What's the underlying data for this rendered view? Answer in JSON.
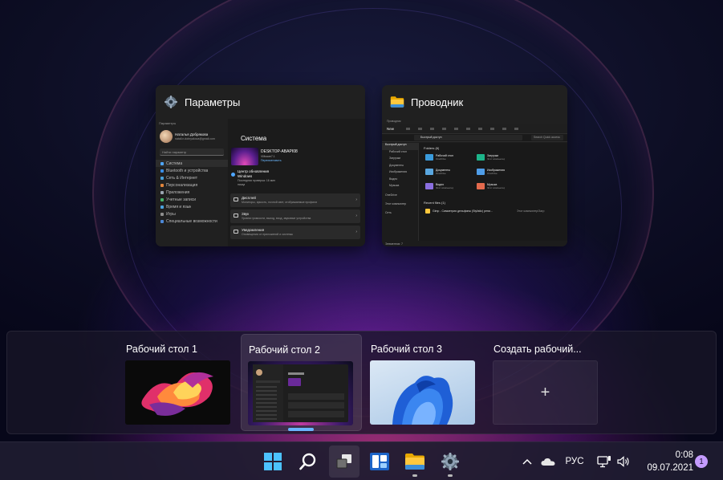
{
  "windows": [
    {
      "title": "Параметры",
      "preview": {
        "topbar": "Параметры",
        "user_name": "Наталья Добрякова",
        "user_email": "natali.n.dobryakova@gmail.com",
        "search_placeholder": "Найти параметр",
        "nav": [
          "Система",
          "Bluetooth и устройства",
          "Сеть & Интернет",
          "Персонализация",
          "Приложения",
          "Учетные записи",
          "Время и язык",
          "Игры",
          "Специальные возможности"
        ],
        "page_title": "Система",
        "device_name": "DESKTOP-ABAPI08",
        "device_sub1": "VMware7.1",
        "device_sub2": "Переименовать",
        "update_title": "Центр обновления",
        "update_title2": "Windows",
        "update_sub": "Последняя проверка: 16 мин",
        "update_sub2": "назад",
        "cards": [
          {
            "title": "Дисплей",
            "sub": "Мониторы, яркость, ночной свет, отображаемые профили"
          },
          {
            "title": "Звук",
            "sub": "Уровни громкости, выход, вход, звуковые устройства"
          },
          {
            "title": "Уведомления",
            "sub": "Оповещения от приложений и системы"
          }
        ]
      }
    },
    {
      "title": "Проводник",
      "preview": {
        "topbar": "Проводник",
        "new_label": "New",
        "address": "Быстрый доступ",
        "search_placeholder": "Search Quick access",
        "tree": [
          "Быстрый доступ",
          "Рабочий стол",
          "Загрузки",
          "Документы",
          "Изображения",
          "Видео",
          "Музыка",
          "OneDrive",
          "Этот компьютер",
          "Сеть"
        ],
        "folders_header": "Folders (6)",
        "folders": [
          {
            "name": "Рабочий стол",
            "sub": "OneDrive"
          },
          {
            "name": "Загрузки",
            "sub": "Этот компьютер"
          },
          {
            "name": "Документы",
            "sub": "OneDrive"
          },
          {
            "name": "Изображения",
            "sub": "OneDrive"
          },
          {
            "name": "Видео",
            "sub": "Этот компьютер"
          },
          {
            "name": "Музыка",
            "sub": "Этот компьютер"
          }
        ],
        "recent_header": "Recent files (1)",
        "recent_file": "Gimp - Симметрия дельфины (Stylistic) репи...",
        "recent_file_loc": "Этот компьютер\\Загр",
        "status": "Элементов: 7"
      }
    }
  ],
  "desktops": [
    {
      "label": "Рабочий стол 1",
      "active": false
    },
    {
      "label": "Рабочий стол 2",
      "active": true
    },
    {
      "label": "Рабочий стол 3",
      "active": false
    },
    {
      "label": "Создать рабочий...",
      "add_symbol": "+"
    }
  ],
  "taskbar": {
    "icons": [
      "windows-start-icon",
      "search-icon",
      "task-view-icon",
      "widgets-icon",
      "file-explorer-icon",
      "settings-icon"
    ],
    "tray": {
      "language": "РУС",
      "time": "0:08",
      "date": "09.07.2021",
      "notifications_count": "1"
    }
  },
  "colors": {
    "accent": "#6ab5ff",
    "badge": "#c49bff"
  }
}
